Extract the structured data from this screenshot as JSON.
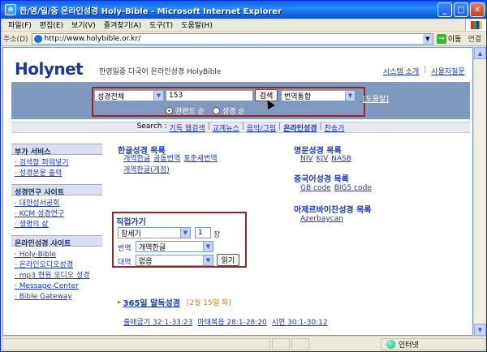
{
  "window": {
    "title": "한/영/일/중 온라인성경 Holy-Bible - Microsoft Internet Explorer",
    "minimize": "_",
    "maximize": "□",
    "close": "✕"
  },
  "menu": [
    "파일(F)",
    "편집(E)",
    "보기(V)",
    "즐겨찾기(A)",
    "도구(T)",
    "도움말(H)"
  ],
  "address": {
    "label": "주소(D)",
    "url": "http://www.holybible.or.kr/",
    "go": "이동",
    "links": "연결"
  },
  "status": {
    "zone": "인터넷"
  },
  "site": {
    "logo": "Holynet",
    "tagline": "한영일중 다국어 온라인성경 HolyBible",
    "top_links": [
      "시스템 소개",
      "사용자질문"
    ],
    "search": {
      "version_select": "성경전체",
      "query": "153",
      "search_button": "검색",
      "mode_select": "번역통합",
      "help": "[도움말]",
      "radio_relevance": "관련도 순",
      "radio_order": "성경 순"
    },
    "nav": {
      "label": "Search :",
      "items": [
        "기독 웹검색",
        "교계뉴스",
        "음악/그림",
        "온라인성경",
        "찬송가"
      ]
    },
    "sidebar": [
      {
        "title": "부가 서비스",
        "items": [
          "검색창 퍼워넣기",
          "성경본문 출력"
        ]
      },
      {
        "title": "성경연구 사이트",
        "items": [
          "대한성서공회",
          "KCM 성경연구",
          "생명의 삶"
        ]
      },
      {
        "title": "온라인성경 사이트",
        "items": [
          "Holy-Bible",
          "온라인오디오성경",
          "mp3 현원 오디오 성경",
          "Message-Center",
          "Bible Gateway"
        ]
      }
    ],
    "korean_bibles": {
      "title": "한글성경 목록",
      "rows": [
        [
          "개역한글",
          "공동번역",
          "표준새번역"
        ],
        [
          "개역한글(개정)"
        ]
      ]
    },
    "famous_bibles": {
      "title": "명문성경 목록",
      "items": [
        "NIV",
        "KJV",
        "NASB"
      ]
    },
    "chinese_bibles": {
      "title": "중국어성경 목록",
      "items": [
        "GB code",
        "BIG5 code"
      ]
    },
    "azerbaijani": {
      "title": "아제르바이잔성경 목록",
      "items": [
        "Azerbaycan"
      ]
    },
    "direct": {
      "title": "직접가기",
      "book": "창세기",
      "chapter": "1",
      "chapter_suffix": "장",
      "version_label": "번역",
      "version": "개역한글",
      "compare_label": "대역",
      "compare": "없음",
      "read_button": "읽기"
    },
    "reading": {
      "title": "365일 말독성경",
      "date": "[2월 15일 화]",
      "links": [
        "출애굽기 32:1-33:23",
        "마태복음 28:1-28:20",
        "시편 30:1-30:12"
      ]
    }
  }
}
